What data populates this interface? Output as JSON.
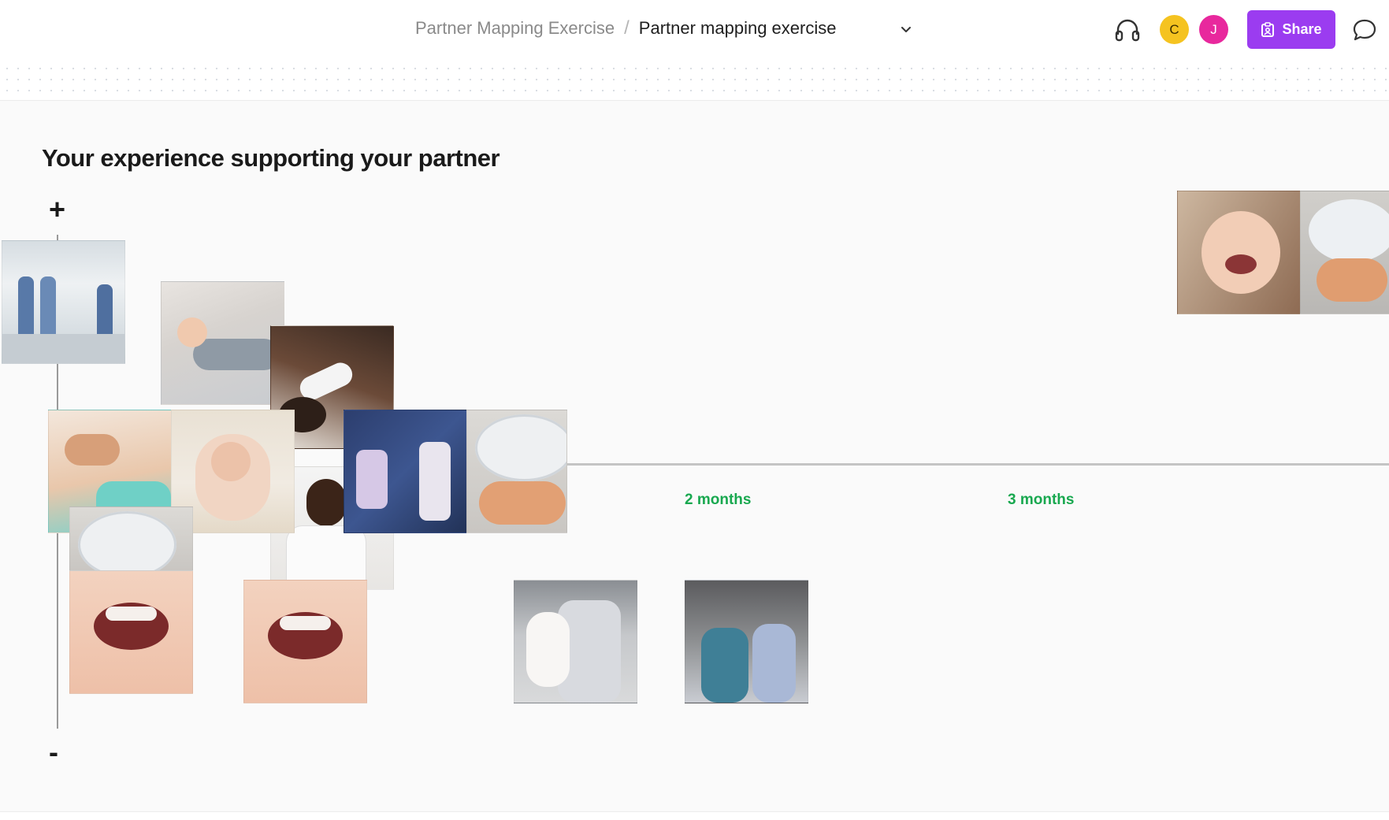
{
  "header": {
    "breadcrumb_parent": "Partner Mapping Exercise",
    "breadcrumb_separator": "/",
    "breadcrumb_current": "Partner mapping exercise",
    "share_label": "Share",
    "avatars": [
      {
        "initial": "C",
        "color": "#f5c320"
      },
      {
        "initial": "J",
        "color": "#e8289d"
      }
    ],
    "icons": [
      "chevron-down-icon",
      "headset-icon",
      "share-board-icon",
      "comment-icon"
    ],
    "share_color": "#9b3cf0"
  },
  "board": {
    "title": "Your experience supporting your partner",
    "axis_positive": "+",
    "axis_negative": "-",
    "timeline_labels": [
      "2 months",
      "3 months"
    ],
    "timeline_label_color": "#18a84f",
    "photos": [
      "hospital-staff-photo",
      "dad-napping-with-baby-photo",
      "bottle-feeding-photo",
      "diaper-change-photo",
      "baby-bath-photo",
      "doctor-photo",
      "breast-pump-photo",
      "baby-on-pillow-photo",
      "baby-on-pillow-photo",
      "crying-baby-photo",
      "crying-baby-closeup-photo",
      "dad-holding-crying-baby-photo",
      "tired-parents-photo",
      "laughing-baby-photo",
      "baby-on-pillow-photo"
    ]
  }
}
